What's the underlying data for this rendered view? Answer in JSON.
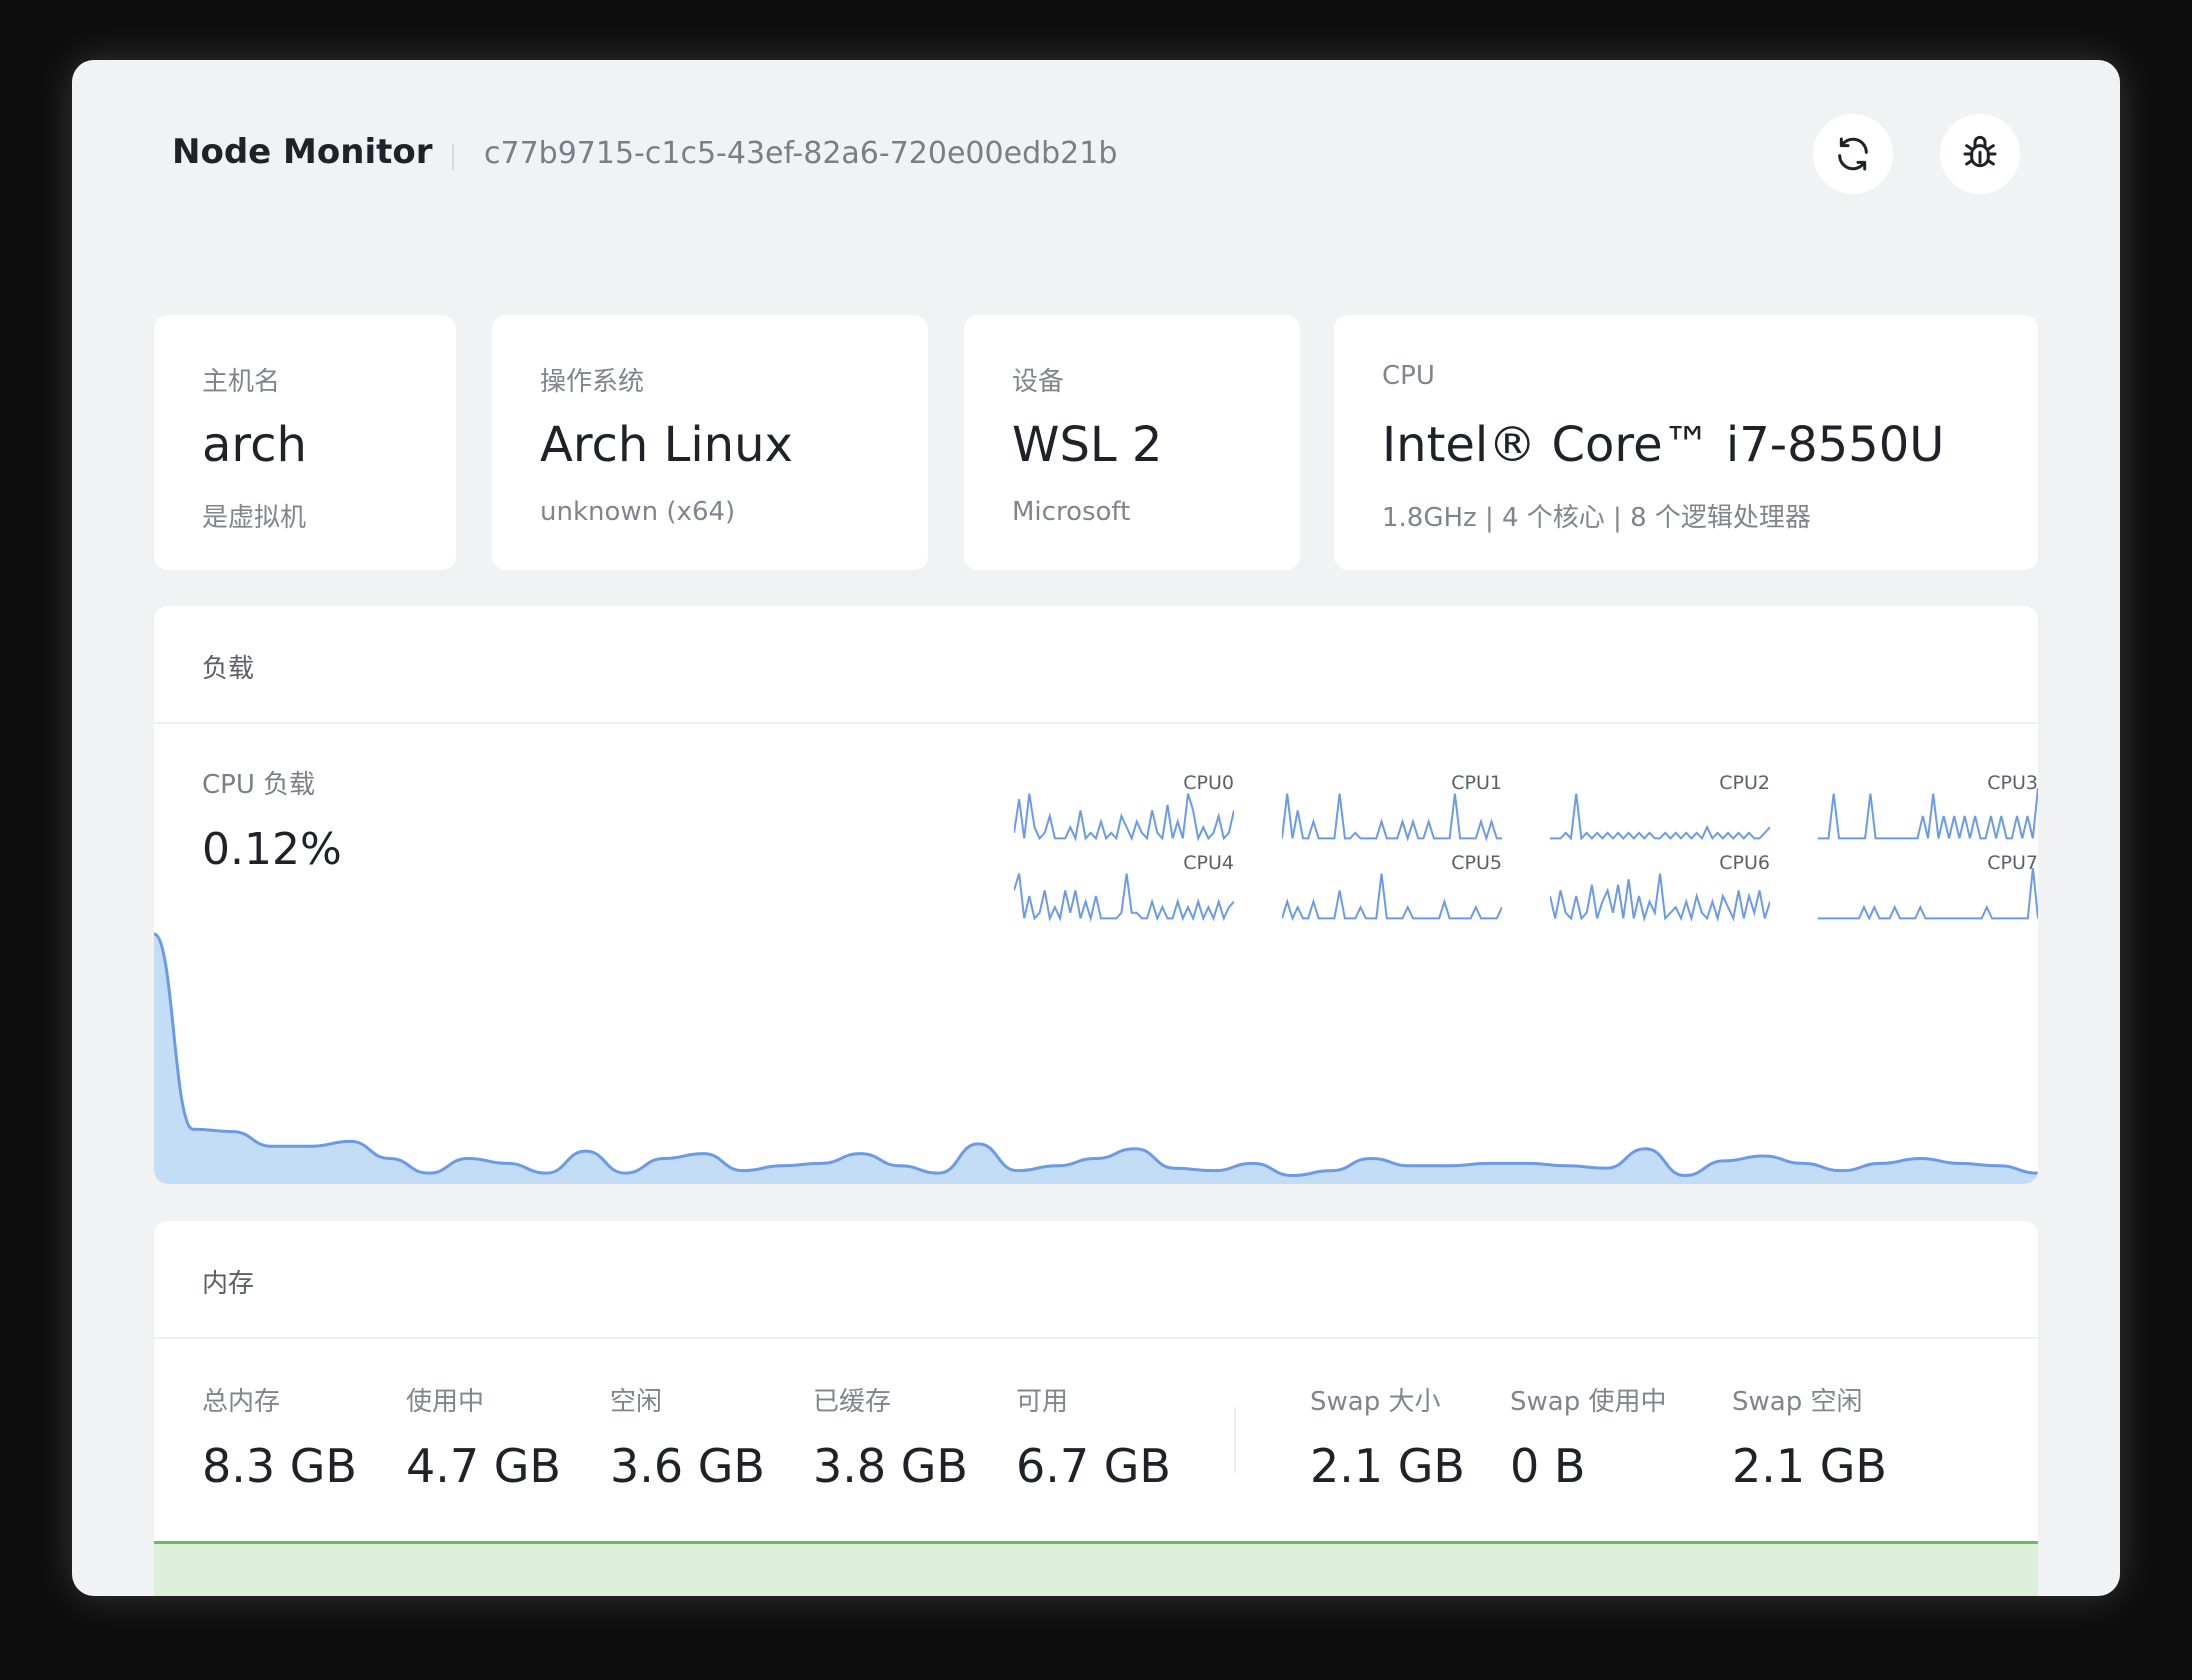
{
  "header": {
    "app_title": "Node Monitor",
    "node_id": "c77b9715-c1c5-43ef-82a6-720e00edb21b",
    "refresh_icon": "refresh-icon",
    "debug_icon": "bug-icon"
  },
  "info_cards": [
    {
      "label": "主机名",
      "value": "arch",
      "sub": "是虚拟机"
    },
    {
      "label": "操作系统",
      "value": "Arch Linux",
      "sub": "unknown (x64)"
    },
    {
      "label": "设备",
      "value": "WSL 2",
      "sub": "Microsoft"
    },
    {
      "label": "CPU",
      "value": "Intel® Core™ i7-8550U",
      "sub": "1.8GHz | 4 个核心 | 8 个逻辑处理器"
    }
  ],
  "load": {
    "title": "负载",
    "cpu_label": "CPU 负载",
    "cpu_value": "0.12%",
    "cores": [
      {
        "name": "CPU0",
        "values": [
          0.2,
          0.8,
          0.1,
          0.9,
          0.3,
          0.1,
          0.2,
          0.5,
          0.1,
          0.1,
          0.1,
          0.3,
          0.1,
          0.6,
          0.1,
          0.2,
          0.1,
          0.4,
          0.1,
          0.2,
          0.1,
          0.5,
          0.3,
          0.1,
          0.4,
          0.2,
          0.1,
          0.6,
          0.2,
          0.1,
          0.7,
          0.1,
          0.4,
          0.1,
          0.9,
          0.6,
          0.1,
          0.3,
          0.1,
          0.2,
          0.5,
          0.1,
          0.2,
          0.6
        ]
      },
      {
        "name": "CPU1",
        "values": [
          0.1,
          0.9,
          0.1,
          0.6,
          0.1,
          0.1,
          0.4,
          0.1,
          0.1,
          0.1,
          0.1,
          0.9,
          0.1,
          0.1,
          0.2,
          0.1,
          0.1,
          0.1,
          0.1,
          0.4,
          0.1,
          0.1,
          0.1,
          0.4,
          0.1,
          0.4,
          0.1,
          0.1,
          0.4,
          0.1,
          0.1,
          0.1,
          0.1,
          0.9,
          0.1,
          0.1,
          0.1,
          0.1,
          0.4,
          0.1,
          0.4,
          0.1,
          0.1
        ]
      },
      {
        "name": "CPU2",
        "values": [
          0.1,
          0.1,
          0.1,
          0.2,
          0.1,
          0.9,
          0.1,
          0.2,
          0.1,
          0.2,
          0.1,
          0.2,
          0.1,
          0.2,
          0.1,
          0.2,
          0.1,
          0.2,
          0.1,
          0.2,
          0.1,
          0.1,
          0.2,
          0.1,
          0.2,
          0.1,
          0.2,
          0.1,
          0.2,
          0.1,
          0.3,
          0.1,
          0.2,
          0.1,
          0.2,
          0.1,
          0.2,
          0.1,
          0.2,
          0.1,
          0.1,
          0.2,
          0.3
        ]
      },
      {
        "name": "CPU3",
        "values": [
          0.1,
          0.1,
          0.1,
          0.9,
          0.1,
          0.1,
          0.1,
          0.1,
          0.1,
          0.1,
          0.9,
          0.1,
          0.1,
          0.1,
          0.1,
          0.1,
          0.1,
          0.1,
          0.1,
          0.1,
          0.5,
          0.1,
          0.9,
          0.1,
          0.5,
          0.1,
          0.5,
          0.1,
          0.5,
          0.1,
          0.5,
          0.1,
          0.1,
          0.5,
          0.1,
          0.5,
          0.1,
          0.1,
          0.5,
          0.1,
          0.5,
          0.1,
          1.0
        ]
      },
      {
        "name": "CPU4",
        "values": [
          0.6,
          0.9,
          0.1,
          0.5,
          0.1,
          0.2,
          0.6,
          0.1,
          0.3,
          0.1,
          0.6,
          0.2,
          0.6,
          0.1,
          0.4,
          0.1,
          0.5,
          0.1,
          0.1,
          0.1,
          0.1,
          0.2,
          0.9,
          0.2,
          0.2,
          0.1,
          0.1,
          0.4,
          0.1,
          0.3,
          0.1,
          0.1,
          0.4,
          0.1,
          0.3,
          0.1,
          0.4,
          0.1,
          0.3,
          0.1,
          0.4,
          0.1,
          0.3,
          0.4
        ]
      },
      {
        "name": "CPU5",
        "values": [
          0.1,
          0.4,
          0.1,
          0.3,
          0.1,
          0.1,
          0.4,
          0.1,
          0.1,
          0.1,
          0.1,
          0.6,
          0.1,
          0.1,
          0.1,
          0.3,
          0.1,
          0.1,
          0.1,
          0.9,
          0.1,
          0.1,
          0.1,
          0.1,
          0.3,
          0.1,
          0.1,
          0.1,
          0.1,
          0.1,
          0.1,
          0.4,
          0.1,
          0.1,
          0.1,
          0.1,
          0.1,
          0.3,
          0.1,
          0.1,
          0.1,
          0.1,
          0.3
        ]
      },
      {
        "name": "CPU6",
        "values": [
          0.5,
          0.1,
          0.6,
          0.2,
          0.1,
          0.5,
          0.1,
          0.2,
          0.7,
          0.1,
          0.4,
          0.6,
          0.2,
          0.7,
          0.1,
          0.8,
          0.1,
          0.5,
          0.1,
          0.4,
          0.2,
          0.9,
          0.1,
          0.2,
          0.3,
          0.1,
          0.4,
          0.1,
          0.5,
          0.2,
          0.1,
          0.4,
          0.1,
          0.5,
          0.3,
          0.1,
          0.6,
          0.1,
          0.5,
          0.2,
          0.6,
          0.1,
          0.4
        ]
      },
      {
        "name": "CPU7",
        "values": [
          0.1,
          0.1,
          0.1,
          0.1,
          0.1,
          0.1,
          0.1,
          0.1,
          0.1,
          0.3,
          0.1,
          0.3,
          0.1,
          0.1,
          0.1,
          0.3,
          0.1,
          0.1,
          0.1,
          0.1,
          0.3,
          0.1,
          0.1,
          0.1,
          0.1,
          0.1,
          0.1,
          0.1,
          0.1,
          0.1,
          0.1,
          0.1,
          0.1,
          0.3,
          0.1,
          0.1,
          0.1,
          0.1,
          0.1,
          0.1,
          0.1,
          0.1,
          1.0,
          0.1
        ]
      }
    ],
    "history": [
      1.0,
      0.2,
      0.19,
      0.13,
      0.13,
      0.15,
      0.08,
      0.02,
      0.08,
      0.06,
      0.02,
      0.11,
      0.02,
      0.08,
      0.1,
      0.03,
      0.05,
      0.06,
      0.1,
      0.05,
      0.02,
      0.14,
      0.03,
      0.05,
      0.08,
      0.12,
      0.04,
      0.03,
      0.06,
      0.01,
      0.03,
      0.08,
      0.05,
      0.05,
      0.06,
      0.06,
      0.05,
      0.04,
      0.12,
      0.01,
      0.07,
      0.09,
      0.06,
      0.03,
      0.06,
      0.08,
      0.06,
      0.05,
      0.02
    ]
  },
  "memory": {
    "title": "内存",
    "stats": [
      {
        "label": "总内存",
        "value": "8.3 GB"
      },
      {
        "label": "使用中",
        "value": "4.7 GB"
      },
      {
        "label": "空闲",
        "value": "3.6 GB"
      },
      {
        "label": "已缓存",
        "value": "3.8 GB"
      },
      {
        "label": "可用",
        "value": "6.7 GB"
      }
    ],
    "swap": [
      {
        "label": "Swap 大小",
        "value": "2.1 GB"
      },
      {
        "label": "Swap 使用中",
        "value": "0 B"
      },
      {
        "label": "Swap 空闲",
        "value": "2.1 GB"
      }
    ]
  },
  "colors": {
    "accent_blue": "#6b9be6",
    "chart_fill": "#c4ddf6",
    "memory_green": "#6cbb6c",
    "memory_fill": "#dcefd8"
  }
}
